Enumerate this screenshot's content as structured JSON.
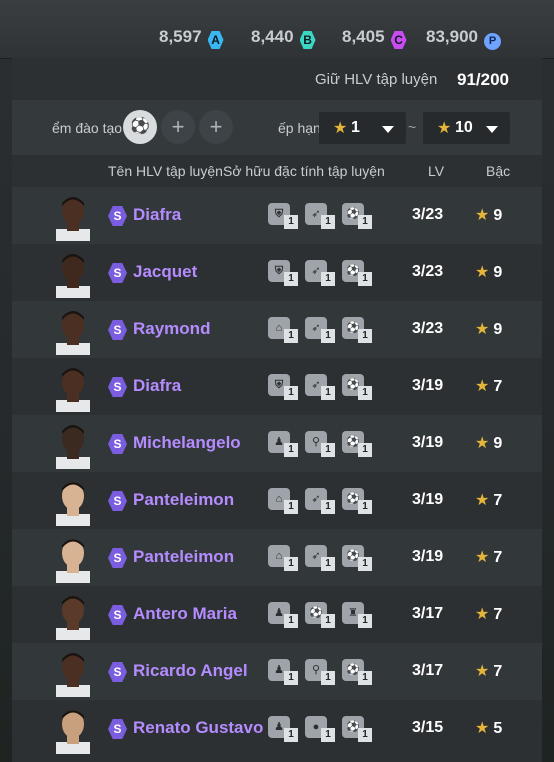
{
  "currency": [
    {
      "value": "8,597",
      "badge": "A",
      "color": "#3ab6f0"
    },
    {
      "value": "8,440",
      "badge": "B",
      "color": "#3ad7c2"
    },
    {
      "value": "8,405",
      "badge": "C",
      "color": "#c84cf0"
    },
    {
      "value": "83,900",
      "badge": "P",
      "color": "#6fa3ff"
    }
  ],
  "trainer_hold": {
    "label": "Giữ HLV tập luyện",
    "count": "91/200"
  },
  "filter": {
    "training_label": "ểm đào tạo",
    "rank_label": "ếp hạng",
    "rank_from": "1",
    "rank_to": "10",
    "separator": "~",
    "add_symbol": "+"
  },
  "columns": {
    "name": "Tên HLV tập luyện",
    "traits": "Sở hữu đặc tính tập luyện",
    "lv": "LV",
    "rank": "Bậc"
  },
  "rows": [
    {
      "name": "Diafra",
      "lv": "3/23",
      "rank": "9",
      "traits": [
        "shield-icon",
        "speed-icon",
        "shot-icon"
      ],
      "trait_counts": [
        "1",
        "1",
        "1"
      ],
      "skin": "#4a2f22"
    },
    {
      "name": "Jacquet",
      "lv": "3/23",
      "rank": "9",
      "traits": [
        "shield-icon",
        "speed-icon",
        "shot-icon"
      ],
      "trait_counts": [
        "1",
        "1",
        "1"
      ],
      "skin": "#3f291e"
    },
    {
      "name": "Raymond",
      "lv": "3/23",
      "rank": "9",
      "traits": [
        "goal-icon",
        "speed-icon",
        "shot-icon"
      ],
      "trait_counts": [
        "1",
        "1",
        "1"
      ],
      "skin": "#4a2f22"
    },
    {
      "name": "Diafra",
      "lv": "3/19",
      "rank": "7",
      "traits": [
        "shield-icon",
        "speed-icon",
        "shot-icon"
      ],
      "trait_counts": [
        "1",
        "1",
        "1"
      ],
      "skin": "#4a2f22"
    },
    {
      "name": "Michelangelo",
      "lv": "3/19",
      "rank": "9",
      "traits": [
        "run-icon",
        "tie-icon",
        "shot-icon"
      ],
      "trait_counts": [
        "1",
        "1",
        "1"
      ],
      "skin": "#3a2a20"
    },
    {
      "name": "Panteleimon",
      "lv": "3/19",
      "rank": "7",
      "traits": [
        "goal-icon",
        "speed-icon",
        "shot-icon"
      ],
      "trait_counts": [
        "1",
        "1",
        "1"
      ],
      "skin": "#d7b394"
    },
    {
      "name": "Panteleimon",
      "lv": "3/19",
      "rank": "7",
      "traits": [
        "goal-icon",
        "speed-icon",
        "shot-icon"
      ],
      "trait_counts": [
        "1",
        "1",
        "1"
      ],
      "skin": "#d7b394"
    },
    {
      "name": "Antero Maria",
      "lv": "3/17",
      "rank": "7",
      "traits": [
        "run-icon",
        "shot-icon",
        "fortress-icon"
      ],
      "trait_counts": [
        "1",
        "1",
        "1"
      ],
      "skin": "#5a3b2a"
    },
    {
      "name": "Ricardo Angel",
      "lv": "3/17",
      "rank": "7",
      "traits": [
        "run-icon",
        "tie-icon",
        "shot-icon"
      ],
      "trait_counts": [
        "1",
        "1",
        "1"
      ],
      "skin": "#4a2f22"
    },
    {
      "name": "Renato Gustavo",
      "lv": "3/15",
      "rank": "5",
      "traits": [
        "run-icon",
        "ball-icon",
        "shot-icon"
      ],
      "trait_counts": [
        "1",
        "1",
        "1"
      ],
      "skin": "#c9a07e"
    }
  ]
}
